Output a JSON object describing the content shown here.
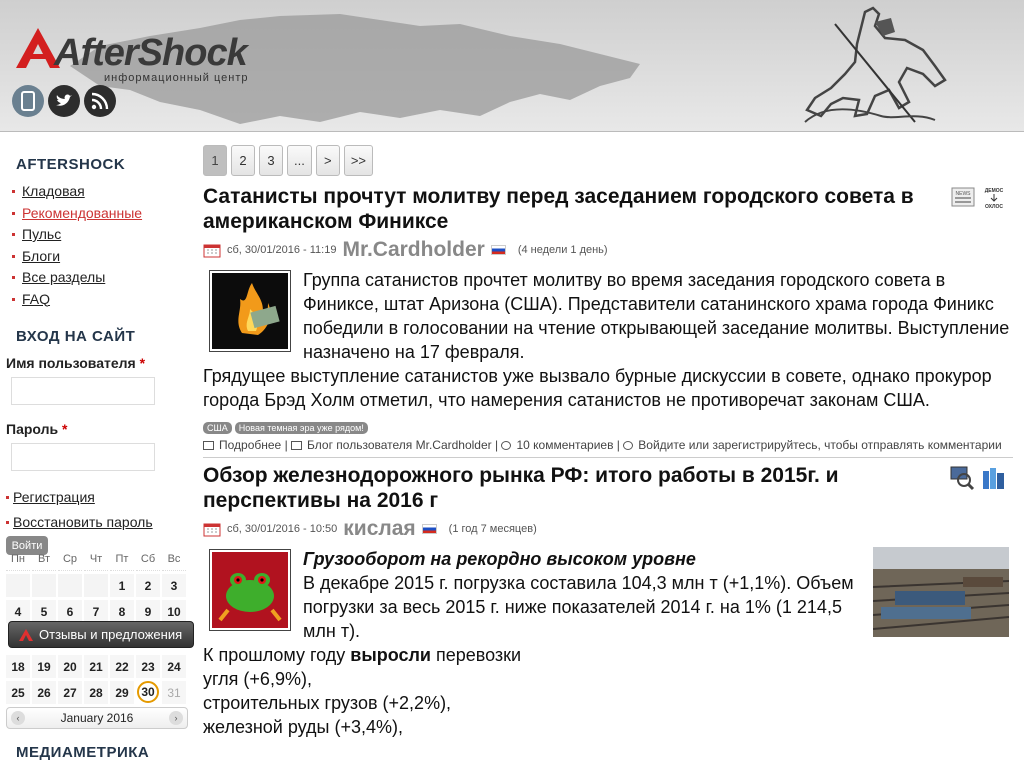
{
  "header": {
    "logo_text": "AfterShock",
    "logo_subtitle": "информационный центр",
    "social_icons": [
      "mobile-icon",
      "twitter-icon",
      "rss-icon"
    ]
  },
  "sidebar": {
    "title": "AFTERSHOCK",
    "menu": [
      {
        "label": "Кладовая"
      },
      {
        "label": "Рекомендованные"
      },
      {
        "label": "Пульс"
      },
      {
        "label": "Блоги"
      },
      {
        "label": "Все разделы"
      },
      {
        "label": "FAQ"
      }
    ],
    "login_title": "ВХОД НА САЙТ",
    "username_label": "Имя пользователя",
    "password_label": "Пароль",
    "required_mark": "*",
    "register_link": "Регистрация",
    "restore_link": "Восстановить пароль",
    "login_button": "Войти",
    "calendar": {
      "weekdays": [
        "Пн",
        "Вт",
        "Ср",
        "Чт",
        "Пт",
        "Сб",
        "Вс"
      ],
      "week1": [
        "",
        "",
        "",
        "",
        "1",
        "2",
        "3"
      ],
      "week2": [
        "4",
        "5",
        "6",
        "7",
        "8",
        "9",
        "10"
      ],
      "week4": [
        "18",
        "19",
        "20",
        "21",
        "22",
        "23",
        "24"
      ],
      "week5": [
        "25",
        "26",
        "27",
        "28",
        "29",
        "30",
        "31"
      ],
      "today": "30",
      "month_label": "January 2016",
      "prev": "‹",
      "next": "›"
    },
    "feedback_label": "Отзывы и предложения",
    "mediametrics_title": "МЕДИАМЕТРИКА"
  },
  "pager": [
    "1",
    "2",
    "3",
    "...",
    ">",
    ">>"
  ],
  "articles": [
    {
      "title": "Сатанисты прочтут молитву перед заседанием городского совета в американском Финиксе",
      "date": "сб, 30/01/2016 - 11:19",
      "author": "Mr.Cardholder",
      "age": "(4 недели 1 день)",
      "body": "Группа сатанистов прочтет молитву во время заседания городского совета в Финиксе, штат Аризона (США). Представители сатанинского храма города Финикс победили в голосовании на чтение открывающей заседание молитвы. Выступление назначено на 17 февраля.",
      "body2": "Грядущее выступление сатанистов уже вызвало бурные дискуссии в совете, однако прокурор города Брэд Холм отметил, что намерения сатанистов не противоречат законам США.",
      "tags": [
        "США",
        "Новая темная эра уже рядом!"
      ],
      "link_more": "Подробнее",
      "link_blog": "Блог пользователя Mr.Cardholder",
      "link_comments": "10 комментариев",
      "link_login": "Войдите или зарегистрируйтесь, чтобы отправлять комментарии",
      "icon_labels": [
        "NEWS",
        "ДЕМОС",
        "ОХЛОС"
      ]
    },
    {
      "title": "Обзор железнодорожного рынка РФ: итого работы в 2015г. и перспективы на 2016 г",
      "date": "сб, 30/01/2016 - 10:50",
      "author": "кислая",
      "age": "(1 год 7 месяцев)",
      "subtitle": "Грузооборот на рекордно высоком уровне",
      "p1": "В декабре 2015 г. погрузка составила 104,3 млн т (+1,1%). Объем погрузки за весь 2015 г. ниже показателей 2014 г. на 1% (1 214,5 млн т).",
      "p2_pre": "К прошлому году ",
      "p2_bold": "выросли",
      "p2_post": " перевозки",
      "l1": "угля (+6,9%),",
      "l2": "строительных грузов (+2,2%),",
      "l3": "железной руды (+3,4%),"
    }
  ]
}
